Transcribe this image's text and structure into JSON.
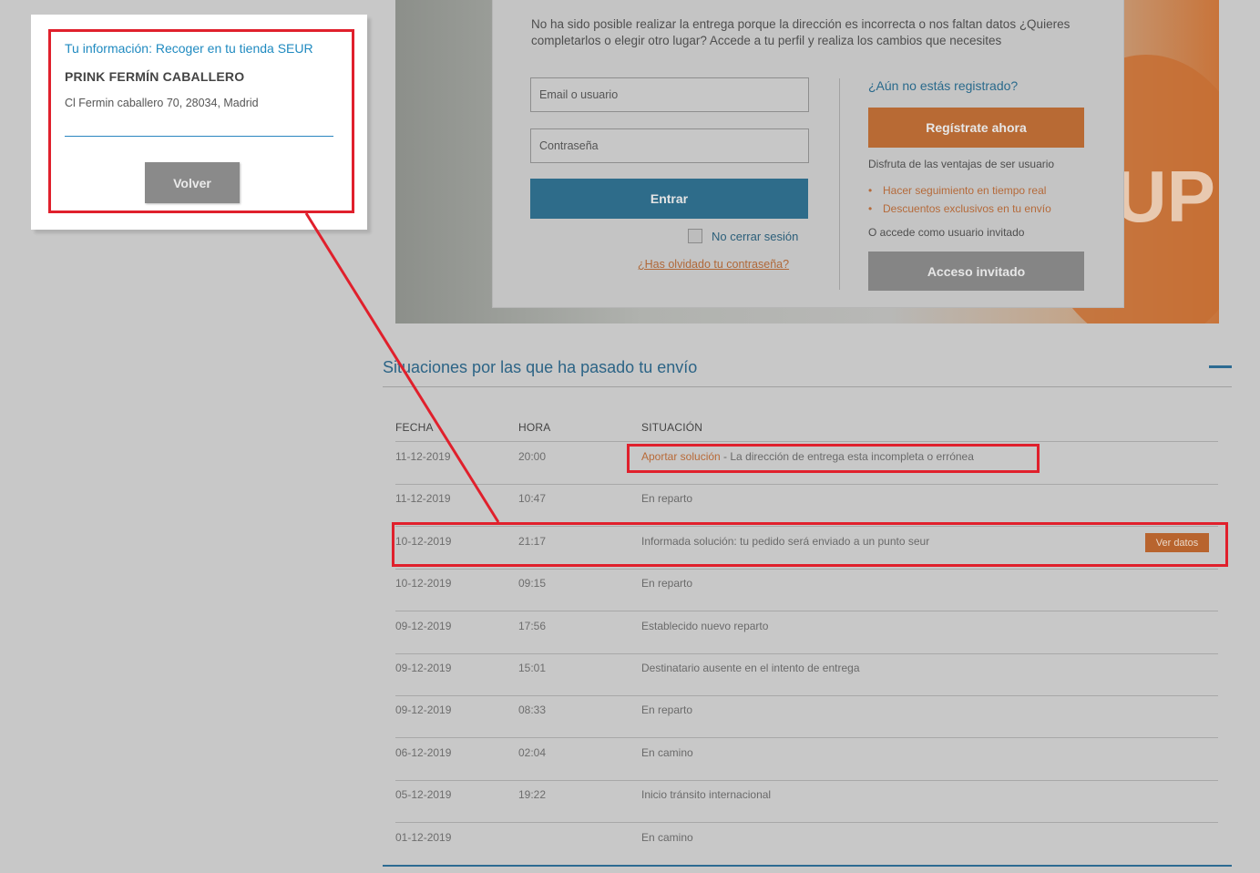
{
  "login": {
    "message": "No ha sido posible realizar la entrega porque la dirección es incorrecta o nos faltan datos ¿Quieres completarlos o elegir otro lugar? Accede a tu perfil y realiza los cambios que necesites",
    "email_placeholder": "Email o usuario",
    "password_placeholder": "Contraseña",
    "enter_label": "Entrar",
    "keep_session_label": "No cerrar sesión",
    "forgot_label": "¿Has olvidado tu contraseña?",
    "not_registered_label": "¿Aún no estás registrado?",
    "register_label": "Regístrate ahora",
    "enjoy_text": "Disfruta de las ventajas de ser usuario",
    "benefits": [
      "Hacer seguimiento en tiempo real",
      "Descuentos exclusivos en tu envío"
    ],
    "guest_text": "O accede como usuario invitado",
    "guest_label": "Acceso invitado",
    "hero_text": "UP"
  },
  "history": {
    "title": "Situaciones por las que ha pasado tu envío",
    "headers": {
      "date": "FECHA",
      "time": "HORA",
      "status": "SITUACIÓN"
    },
    "rows": [
      {
        "date": "11-12-2019",
        "time": "20:00",
        "status_link": "Aportar solución",
        "status": " - La dirección de entrega esta incompleta o errónea"
      },
      {
        "date": "11-12-2019",
        "time": "10:47",
        "status_link": "",
        "status": "En reparto"
      },
      {
        "date": "10-12-2019",
        "time": "21:17",
        "status_link": "",
        "status": "Informada solución: tu pedido será enviado a un punto seur"
      },
      {
        "date": "10-12-2019",
        "time": "09:15",
        "status_link": "",
        "status": "En reparto"
      },
      {
        "date": "09-12-2019",
        "time": "17:56",
        "status_link": "",
        "status": "Establecido nuevo reparto"
      },
      {
        "date": "09-12-2019",
        "time": "15:01",
        "status_link": "",
        "status": "Destinatario ausente en el intento de entrega"
      },
      {
        "date": "09-12-2019",
        "time": "08:33",
        "status_link": "",
        "status": "En reparto"
      },
      {
        "date": "06-12-2019",
        "time": "02:04",
        "status_link": "",
        "status": "En camino"
      },
      {
        "date": "05-12-2019",
        "time": "19:22",
        "status_link": "",
        "status": "Inicio tránsito internacional"
      },
      {
        "date": "01-12-2019",
        "time": "",
        "status_link": "",
        "status": "En camino"
      }
    ],
    "view_data_label": "Ver datos"
  },
  "popup": {
    "title": "Tu información: Recoger en tu tienda SEUR",
    "name": "PRINK FERMÍN CABALLERO",
    "address": "Cl Fermin caballero 70, 28034, Madrid",
    "back_label": "Volver"
  },
  "colors": {
    "annotation": "#e0202c",
    "accent_blue": "#2c6b92",
    "accent_orange": "#b86a34"
  }
}
